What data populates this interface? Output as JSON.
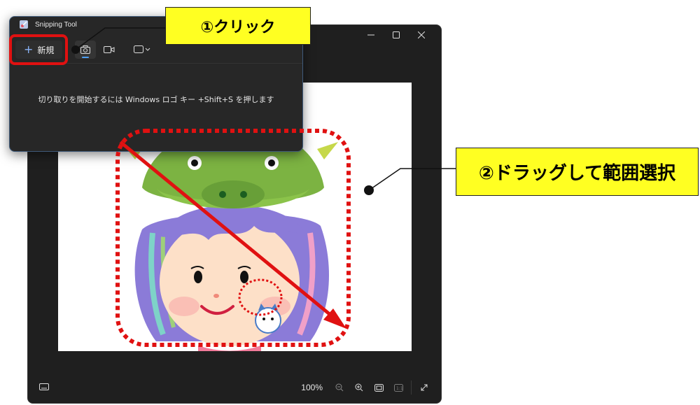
{
  "popup": {
    "title": "Snipping Tool",
    "new_button_label": "新規",
    "hint_text": "切り取りを開始するには Windows ロゴ キー +Shift+S を押します"
  },
  "main_window": {
    "zoom_label": "100%"
  },
  "annotations": {
    "step1": "①クリック",
    "step2": "②ドラッグして範囲選択"
  },
  "colors": {
    "highlight": "#ffff22",
    "annotation_red": "#e01111",
    "window_bg": "#1f1f1f",
    "accent": "#4ea1f5"
  },
  "icons": {
    "capture_modes": [
      "camera-icon",
      "video-icon",
      "rectangle-mode-icon"
    ],
    "bottom_bar": [
      "zoom-out-icon",
      "zoom-in-icon",
      "fit-screen-icon",
      "actual-size-icon",
      "expand-icon"
    ]
  }
}
